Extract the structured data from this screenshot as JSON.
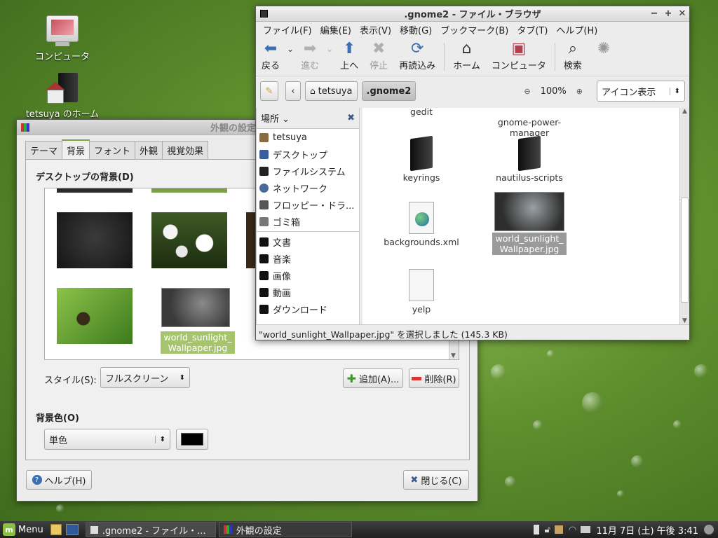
{
  "desktop": {
    "icons": [
      {
        "label": "コンピュータ",
        "icon": "computer-icon"
      },
      {
        "label": "tetsuya のホーム",
        "icon": "home-folder-icon"
      }
    ]
  },
  "browser": {
    "title": ".gnome2 - ファイル・ブラウザ",
    "controls": {
      "minimize": "−",
      "maximize": "+",
      "close": "✕"
    },
    "menu": [
      "ファイル(F)",
      "編集(E)",
      "表示(V)",
      "移動(G)",
      "ブックマーク(B)",
      "タブ(T)",
      "ヘルプ(H)"
    ],
    "toolbar": {
      "back": "戻る",
      "forward": "進む",
      "up": "上へ",
      "stop": "停止",
      "reload": "再読込み",
      "home": "ホーム",
      "computer": "コンピュータ",
      "search": "検索"
    },
    "location": {
      "crumb1": "tetsuya",
      "crumb2": ".gnome2",
      "zoom": "100%",
      "view": "アイコン表示"
    },
    "sidebar": {
      "title": "場所",
      "items": [
        {
          "label": "tetsuya",
          "color": "#8a6a40"
        },
        {
          "label": "デスクトップ",
          "color": "#3a5f9a"
        },
        {
          "label": "ファイルシステム",
          "color": "#222222"
        },
        {
          "label": "ネットワーク",
          "color": "#4a6a9a"
        },
        {
          "label": "フロッピー・ドラ...",
          "color": "#555555"
        },
        {
          "label": "ゴミ箱",
          "color": "#777777"
        }
      ],
      "bookmarks": [
        "文書",
        "音楽",
        "画像",
        "動画",
        "ダウンロード"
      ]
    },
    "files": {
      "gedit": "gedit",
      "gpm": "gnome-power-\nmanager",
      "keyrings": "keyrings",
      "nautilus": "nautilus-scripts",
      "backgrounds": "backgrounds.xml",
      "wallpaper": "world_sunlight_\nWallpaper.jpg",
      "yelp": "yelp"
    },
    "status": "\"world_sunlight_Wallpaper.jpg\" を選択しました (145.3 KB)"
  },
  "appearance": {
    "title": "外観の設定",
    "tabs": [
      "テーマ",
      "背景",
      "フォント",
      "外観",
      "視覚効果"
    ],
    "section_bg": "デスクトップの背景(D)",
    "selected_thumb_label": "world_sunlight_\nWallpaper.jpg",
    "style_label": "スタイル(S):",
    "style_value": "フルスクリーン",
    "add_button": "追加(A)...",
    "remove_button": "削除(R)",
    "bgcolor_label": "背景色(O)",
    "bgcolor_value": "単色",
    "help_button": "ヘルプ(H)",
    "close_button": "閉じる(C)"
  },
  "taskbar": {
    "menu": "Menu",
    "tasks": [
      ".gnome2 - ファイル・...",
      "外観の設定"
    ],
    "clock": "11月 7日 (土) 午後 3:41"
  }
}
